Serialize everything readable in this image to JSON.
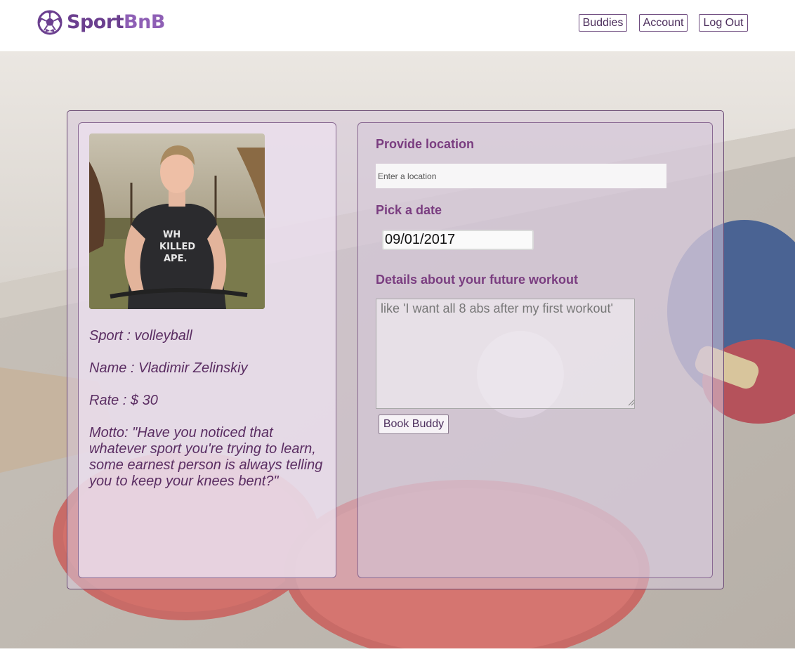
{
  "header": {
    "logo_part1": "Sport",
    "logo_part2": "BnB",
    "logo_icon": "soccer-ball-icon",
    "nav": [
      {
        "label": "Buddies"
      },
      {
        "label": "Account"
      },
      {
        "label": "Log Out"
      }
    ]
  },
  "profile": {
    "sport": "Sport : volleyball",
    "name": "Name : Vladimir Zelinskiy",
    "rate": "Rate : $ 30",
    "motto": "Motto: \"Have you noticed that whatever sport you're trying to learn, some earnest person is always telling you to keep your knees bent?\"",
    "photo_shirt_text": "WHO KILLED APE."
  },
  "form": {
    "location_label": "Provide location",
    "location_placeholder": "Enter a location",
    "date_label": "Pick a date",
    "date_value": "09/01/2017",
    "details_label": "Details about your future workout",
    "details_placeholder": "like 'I want all 8 abs after my first workout'",
    "submit_label": "Book Buddy"
  },
  "colors": {
    "brand": "#6b3f8f",
    "brand_light": "#8e5fb5",
    "label_text": "#7a3d80",
    "panel_border": "#6a4a74"
  }
}
